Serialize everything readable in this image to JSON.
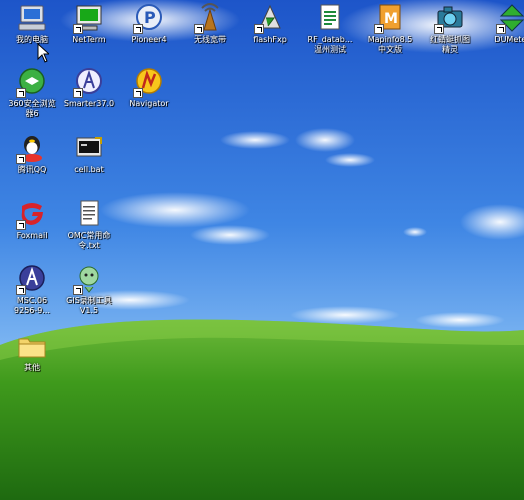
{
  "desktop": {
    "icons": [
      {
        "name": "my-computer-icon",
        "label": "我的电脑"
      },
      {
        "name": "netterm-icon",
        "label": "NetTerm"
      },
      {
        "name": "pioneer4-icon",
        "label": "Pioneer4"
      },
      {
        "name": "wireless-broadband-icon",
        "label": "无线宽带"
      },
      {
        "name": "flashfxp-icon",
        "label": "flashFxp"
      },
      {
        "name": "rf-database-icon",
        "label": "RF_datab...\n温州测试"
      },
      {
        "name": "mapinfo-icon",
        "label": "Mapinfo8.5\n中文版"
      },
      {
        "name": "capture-tool-icon",
        "label": "红蜻蜓抓图\n精灵"
      },
      {
        "name": "dumeter-icon",
        "label": "DUMeter"
      },
      {
        "name": "browser-360-icon",
        "label": "360安全浏览\n器6"
      },
      {
        "name": "smarter37-icon",
        "label": "Smarter37.0"
      },
      {
        "name": "navigator-icon",
        "label": "Navigator"
      },
      {
        "name": "qq-icon",
        "label": "腾讯QQ"
      },
      {
        "name": "cell-bat-icon",
        "label": "cell.bat"
      },
      {
        "name": "foxmail-icon",
        "label": "Foxmail"
      },
      {
        "name": "omc-commands-icon",
        "label": "OMC常用命\n令.txt"
      },
      {
        "name": "msc-icon",
        "label": "MSC.06\n9256-9..."
      },
      {
        "name": "gis-tool-icon",
        "label": "GIS录制工具\nV1.5"
      },
      {
        "name": "other-folder-icon",
        "label": "其他"
      }
    ]
  }
}
